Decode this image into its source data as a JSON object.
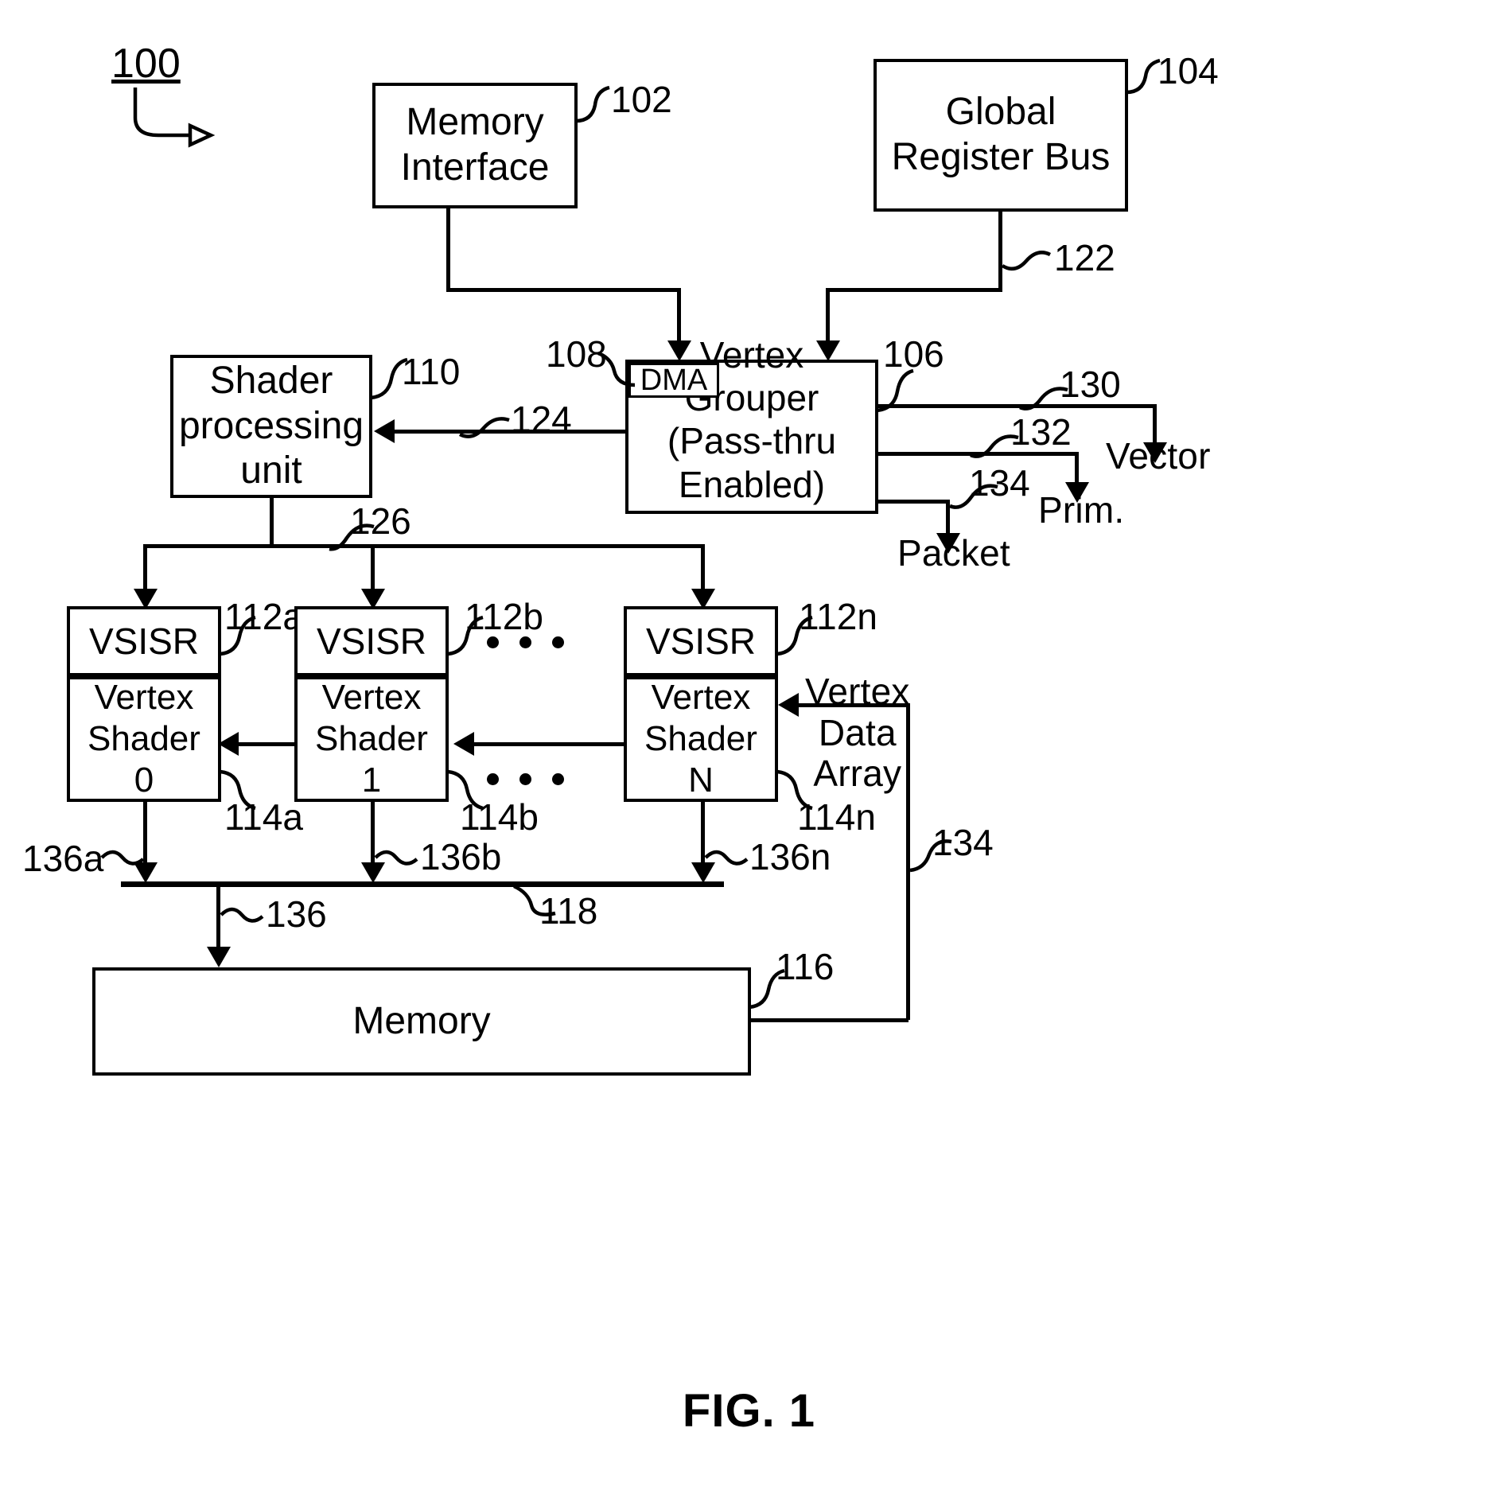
{
  "figure": {
    "caption": "FIG. 1",
    "diagram_number": "100"
  },
  "blocks": {
    "memory_interface": {
      "label": "Memory\nInterface",
      "ref": "102"
    },
    "global_register_bus": {
      "label": "Global\nRegister Bus",
      "ref": "104"
    },
    "vertex_grouper": {
      "label": "Vertex\nGrouper\n(Pass-thru\nEnabled)",
      "ref": "106"
    },
    "dma": {
      "label": "DMA",
      "ref": "108"
    },
    "shader_processing_unit": {
      "label": "Shader\nprocessing\nunit",
      "ref": "110"
    },
    "memory": {
      "label": "Memory",
      "ref": "116"
    }
  },
  "shader_columns": [
    {
      "vsisr_label": "VSISR",
      "vsisr_ref": "112a",
      "shader_label": "Vertex\nShader\n0",
      "shader_ref": "114a",
      "output_ref": "136a"
    },
    {
      "vsisr_label": "VSISR",
      "vsisr_ref": "112b",
      "shader_label": "Vertex\nShader\n1",
      "shader_ref": "114b",
      "output_ref": "136b"
    },
    {
      "vsisr_label": "VSISR",
      "vsisr_ref": "112n",
      "shader_label": "Vertex\nShader\nN",
      "shader_ref": "114n",
      "output_ref": "136n"
    }
  ],
  "outputs": {
    "vector": {
      "label": "Vector",
      "ref": "130"
    },
    "prim": {
      "label": "Prim.",
      "ref": "132"
    },
    "packet": {
      "label": "Packet",
      "ref": "134"
    }
  },
  "connections": {
    "global_register_bus_to_grouper": "122",
    "grouper_to_shader_unit": "124",
    "shader_unit_to_vsisr_bus": "126",
    "shader_output_bus": "118",
    "bus_to_memory": "136",
    "memory_to_vertex_shader_n": "134"
  },
  "annotations": {
    "vertex_data_array": "Vertex\nData\nArray"
  },
  "colors": {
    "ink": "#000000",
    "paper": "#ffffff"
  }
}
